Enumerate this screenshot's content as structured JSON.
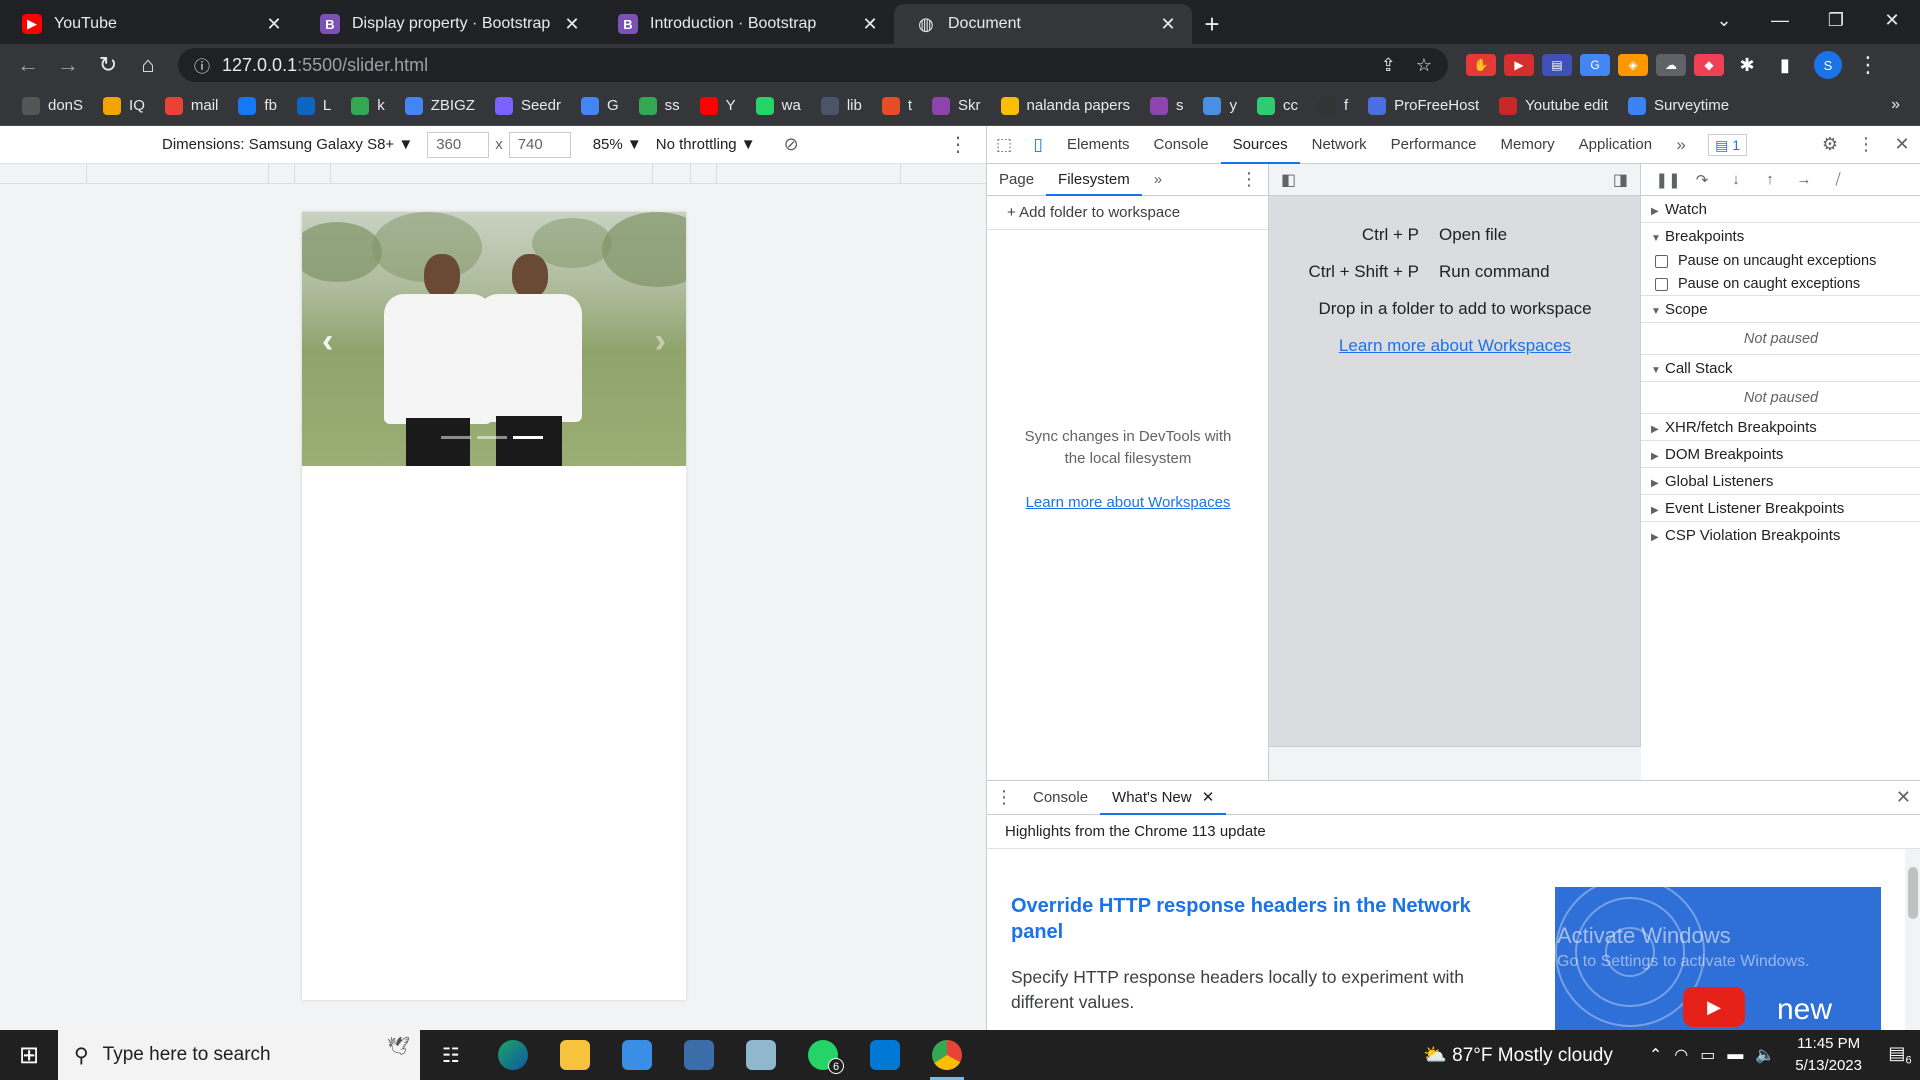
{
  "browser": {
    "tabs": [
      {
        "title": "YouTube",
        "favicon_color": "#ff0000",
        "favicon_glyph": "▶"
      },
      {
        "title": "Display property · Bootstrap",
        "favicon_color": "#7952b3",
        "favicon_glyph": "B"
      },
      {
        "title": "Introduction · Bootstrap",
        "favicon_color": "#7952b3",
        "favicon_glyph": "B"
      },
      {
        "title": "Document",
        "favicon_color": "#5f6368",
        "favicon_glyph": "◍"
      }
    ],
    "url_host": "127.0.0.1",
    "url_rest": ":5500/slider.html",
    "profile_initial": "S",
    "bookmarks": [
      "donS",
      "IQ",
      "mail",
      "fb",
      "L",
      "k",
      "ZBIGZ",
      "Seedr",
      "G",
      "ss",
      "Y",
      "wa",
      "lib",
      "t",
      "Skr",
      "nalanda papers",
      "s",
      "y",
      "cc",
      "f",
      "ProFreeHost",
      "Youtube edit",
      "Surveytime"
    ],
    "bookmark_colors": [
      "#555",
      "#f4a400",
      "#ea4335",
      "#1877f2",
      "#0a66c2",
      "#34a853",
      "#4285f4",
      "#7b61ff",
      "#4285f4",
      "#34a853",
      "#ff0000",
      "#25d366",
      "#4a5568",
      "#e44d26",
      "#8e44ad",
      "#fbbc04",
      "#8e44ad",
      "#4a90e2",
      "#2ecc71",
      "#333",
      "#4a6fe3",
      "#c62828",
      "#3b82f6"
    ]
  },
  "emulation": {
    "device": "Dimensions: Samsung Galaxy S8+ ▼",
    "width": "360",
    "height": "740",
    "times": "x",
    "zoom": "85% ▼",
    "throttling": "No throttling ▼"
  },
  "carousel": {
    "prev": "‹",
    "next": "›",
    "indicator_count": 3,
    "active_indicator": 3
  },
  "devtools": {
    "tabs": [
      "Elements",
      "Console",
      "Sources",
      "Network",
      "Performance",
      "Memory",
      "Application"
    ],
    "active_tab": "Sources",
    "issues_count": "1",
    "navigator_tabs": [
      "Page",
      "Filesystem"
    ],
    "add_folder": "Add folder to workspace",
    "sync_text_1": "Sync changes in DevTools with",
    "sync_text_2": "the local filesystem",
    "learn_more": "Learn more about Workspaces",
    "shortcuts": [
      {
        "keys": "Ctrl + P",
        "action": "Open file"
      },
      {
        "keys": "Ctrl + Shift + P",
        "action": "Run command"
      }
    ],
    "drop_text": "Drop in a folder to add to workspace",
    "debugger": {
      "watch": "Watch",
      "breakpoints": "Breakpoints",
      "pause_uncaught": "Pause on uncaught exceptions",
      "pause_caught": "Pause on caught exceptions",
      "scope": "Scope",
      "not_paused": "Not paused",
      "call_stack": "Call Stack",
      "not_paused_2": "Not paused",
      "xhr": "XHR/fetch Breakpoints",
      "dom": "DOM Breakpoints",
      "global": "Global Listeners",
      "event": "Event Listener Breakpoints",
      "csp": "CSP Violation Breakpoints"
    },
    "drawer": {
      "tabs": [
        "Console",
        "What's New"
      ],
      "highlights": "Highlights from the Chrome 113 update",
      "title": "Override HTTP response headers in the Network panel",
      "body": "Specify HTTP response headers locally to experiment with different values.",
      "thumb_new": "new",
      "watermark_1": "Activate Windows",
      "watermark_2": "Go to Settings to activate Windows."
    }
  },
  "taskbar": {
    "search_placeholder": "Type here to search",
    "weather": "87°F  Mostly cloudy",
    "time": "11:45 PM",
    "date": "5/13/2023",
    "whatsapp_badge": "6",
    "notif_badge": "6"
  }
}
